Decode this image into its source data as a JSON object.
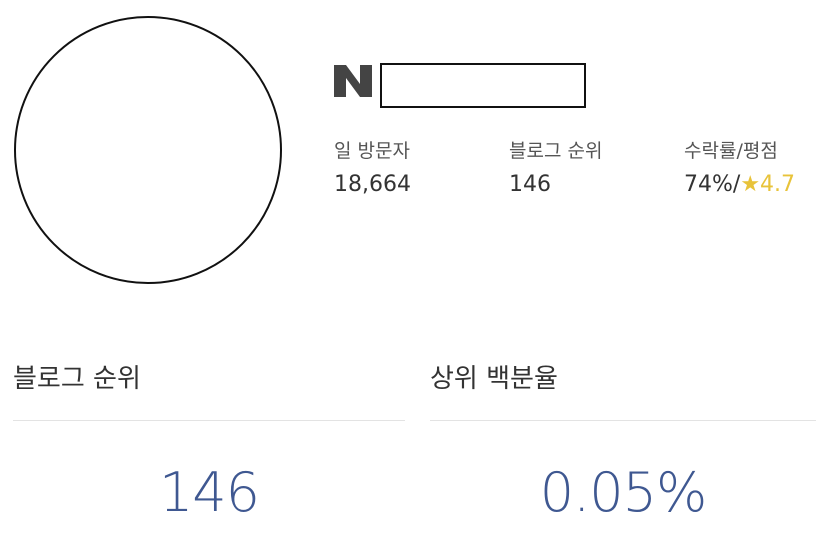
{
  "profile": {
    "icons": {
      "avatar": "avatar-placeholder",
      "brand": "naver-n-icon"
    }
  },
  "stats": {
    "daily_visitors_label": "일 방문자",
    "daily_visitors_value": "18,664",
    "blog_rank_label": "블로그 순위",
    "blog_rank_value": "146",
    "acceptance_label": "수락률/평점",
    "acceptance_value": "74%/",
    "star_glyph": "★",
    "rating_value": "4.7"
  },
  "summary": {
    "rank_title": "블로그 순위",
    "rank_value": "146",
    "percentile_title": "상위 백분율",
    "percentile_value": "0.05%"
  },
  "colors": {
    "accent_number": "#3f5891",
    "star": "#e8c33a",
    "logo": "#444444"
  }
}
